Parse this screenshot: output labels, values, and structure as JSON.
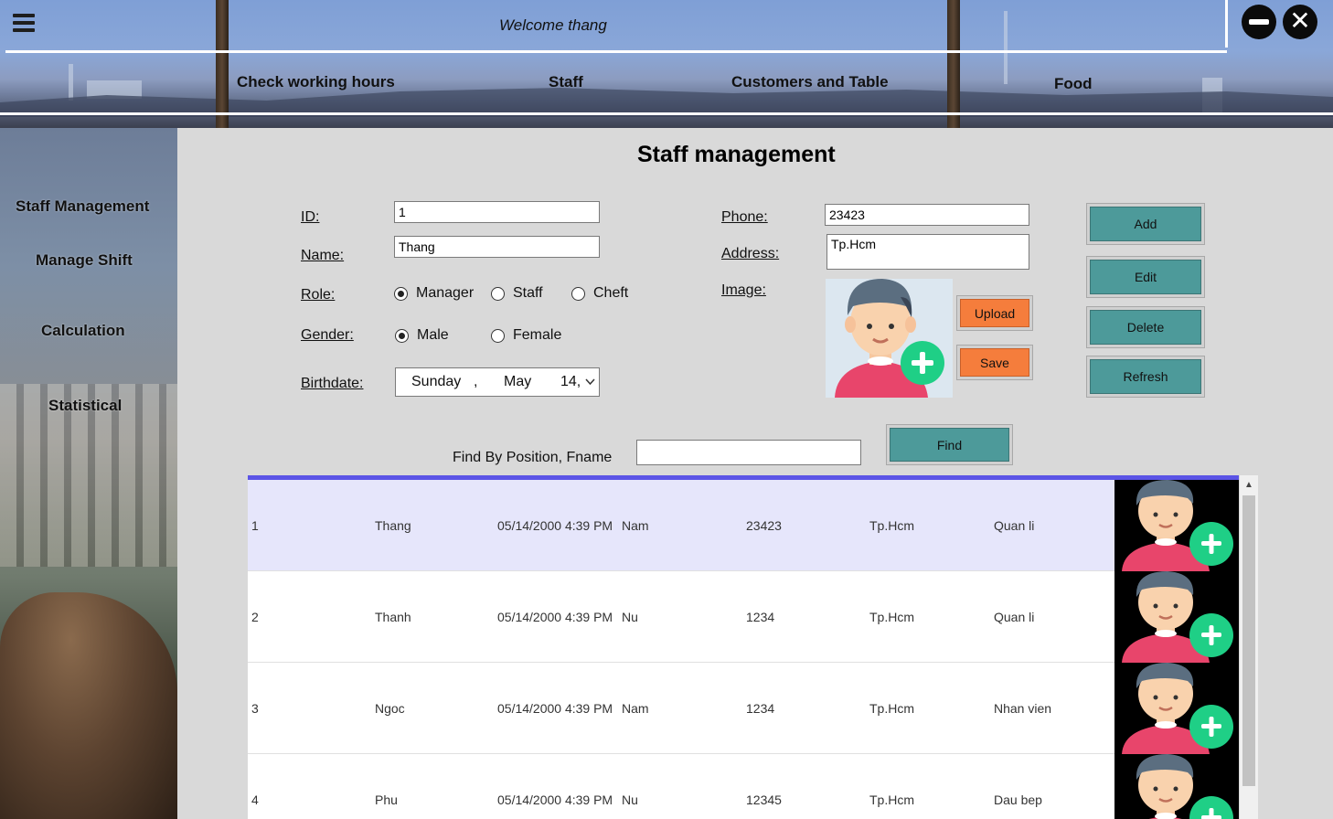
{
  "header": {
    "welcome": "Welcome thang",
    "nav": [
      "Check working hours",
      "Staff",
      "Customers and Table",
      "Food"
    ]
  },
  "sidebar": {
    "items": [
      "Staff Management",
      "Manage Shift",
      "Calculation",
      "Statistical"
    ]
  },
  "main": {
    "title": "Staff management",
    "form": {
      "id_label": "ID:",
      "id_value": "1",
      "name_label": "Name:",
      "name_value": "Thang",
      "role_label": "Role:",
      "roles": [
        "Manager",
        "Staff",
        "Cheft"
      ],
      "role_selected": "Manager",
      "gender_label": "Gender:",
      "genders": [
        "Male",
        "Female"
      ],
      "gender_selected": "Male",
      "birthdate_label": "Birthdate:",
      "birthdate": {
        "weekday": "Sunday",
        "sep": ",",
        "month": "May",
        "day": "14,",
        "dropdown_icon": "chevron-down-icon"
      },
      "phone_label": "Phone:",
      "phone_value": "23423",
      "address_label": "Address:",
      "address_value": "Tp.Hcm",
      "image_label": "Image:"
    },
    "buttons": {
      "upload": "Upload",
      "save": "Save",
      "add": "Add",
      "edit": "Edit",
      "delete": "Delete",
      "refresh": "Refresh",
      "find": "Find"
    },
    "find": {
      "label": "Find By Position, Fname",
      "value": ""
    }
  },
  "grid": {
    "selected_row": 0,
    "rows": [
      {
        "id": "1",
        "name": "Thang",
        "birth": "05/14/2000 4:39 PM",
        "gender": "Nam",
        "phone": "23423",
        "address": "Tp.Hcm",
        "position": "Quan li"
      },
      {
        "id": "2",
        "name": "Thanh",
        "birth": "05/14/2000 4:39 PM",
        "gender": "Nu",
        "phone": "1234",
        "address": "Tp.Hcm",
        "position": "Quan li"
      },
      {
        "id": "3",
        "name": "Ngoc",
        "birth": "05/14/2000 4:39 PM",
        "gender": "Nam",
        "phone": "1234",
        "address": "Tp.Hcm",
        "position": "Nhan vien"
      },
      {
        "id": "4",
        "name": "Phu",
        "birth": "05/14/2000 4:39 PM",
        "gender": "Nu",
        "phone": "12345",
        "address": "Tp.Hcm",
        "position": "Dau bep"
      }
    ]
  },
  "colors": {
    "accent_teal": "#4d9a9a",
    "accent_orange": "#f57d3c",
    "grid_selected": "#e6e6fb",
    "grid_header_line": "#5b54e6"
  }
}
